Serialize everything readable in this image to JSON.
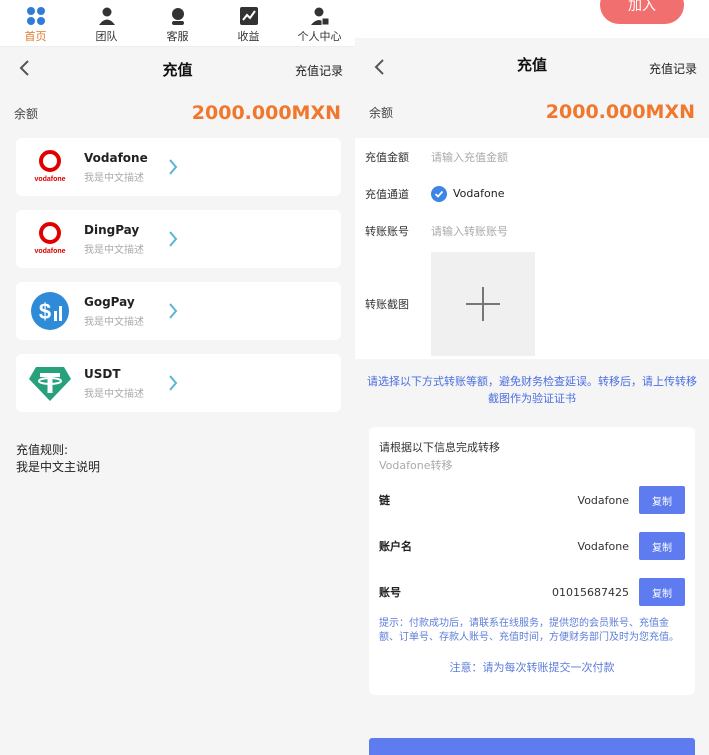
{
  "left": {
    "tabs": [
      {
        "label": "首页",
        "icon": "grid-icon",
        "active": true
      },
      {
        "label": "团队",
        "icon": "team-icon",
        "active": false
      },
      {
        "label": "客服",
        "icon": "support-icon",
        "active": false
      },
      {
        "label": "收益",
        "icon": "chart-icon",
        "active": false
      },
      {
        "label": "个人中心",
        "icon": "profile-icon",
        "active": false
      }
    ],
    "nav": {
      "title": "充值",
      "record": "充值记录"
    },
    "balance": {
      "label": "余额",
      "amount": "2000.000MXN"
    },
    "channels": [
      {
        "name": "Vodafone",
        "desc": "我是中文描述",
        "logo": "vodafone-logo"
      },
      {
        "name": "DingPay",
        "desc": "我是中文描述",
        "logo": "vodafone-logo"
      },
      {
        "name": "GogPay",
        "desc": "我是中文描述",
        "logo": "dollar-coin-logo"
      },
      {
        "name": "USDT",
        "desc": "我是中文描述",
        "logo": "tether-logo"
      }
    ],
    "rules": {
      "title": "充值规则:",
      "body": "我是中文主说明"
    }
  },
  "right": {
    "join_button": "加入",
    "nav": {
      "title": "充值",
      "record": "充值记录"
    },
    "balance": {
      "label": "余额",
      "amount": "2000.000MXN"
    },
    "form": {
      "amount_label": "充值金额",
      "amount_placeholder": "请输入充值金额",
      "channel_label": "充值通道",
      "channel_value": "Vodafone",
      "account_label": "转账账号",
      "account_placeholder": "请输入转账账号",
      "screenshot_label": "转账截图"
    },
    "tip": "请选择以下方式转账等额，避免财务检查延误。转移后，请上传转移截图作为验证证书",
    "info": {
      "title": "请根据以下信息完成转移",
      "subtitle": "Vodafone转移",
      "rows": [
        {
          "label": "链",
          "value": "Vodafone",
          "button": "复制"
        },
        {
          "label": "账户名",
          "value": "Vodafone",
          "button": "复制"
        },
        {
          "label": "账号",
          "value": "01015687425",
          "button": "复制"
        }
      ],
      "hint": "提示：付款成功后，请联系在线服务，提供您的会员账号、充值金额、订单号、存款人账号、充值时间，方便财务部门及时为您充值。",
      "notice": "注意：请为每次转账提交一次付款"
    }
  },
  "colors": {
    "accent_orange": "#f0772b",
    "blue": "#5e7bef",
    "join_red": "#f26f6f",
    "check_blue": "#3d84e6"
  }
}
